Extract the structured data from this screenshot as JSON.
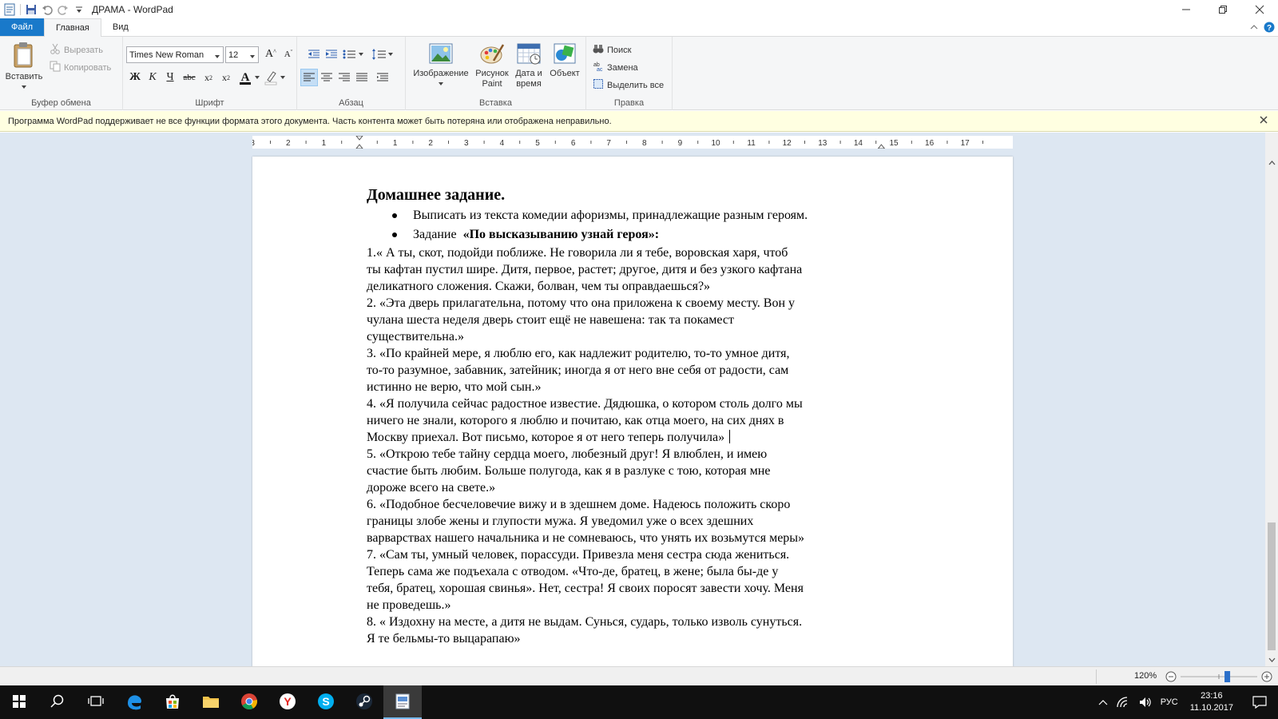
{
  "window": {
    "title": "ДРАМА - WordPad"
  },
  "tabs": {
    "file": "Файл",
    "home": "Главная",
    "view": "Вид"
  },
  "ribbon": {
    "clipboard": {
      "paste": "Вставить",
      "cut": "Вырезать",
      "copy": "Копировать",
      "label": "Буфер обмена"
    },
    "font": {
      "family": "Times New Roman",
      "size": "12",
      "label": "Шрифт",
      "bold": "Ж",
      "italic": "К",
      "underline": "Ч",
      "strike": "abc"
    },
    "paragraph": {
      "label": "Абзац"
    },
    "insert": {
      "image_line1": "Изображение",
      "paint_line1": "Рисунок",
      "paint_line2": "Paint",
      "datetime_line1": "Дата и",
      "datetime_line2": "время",
      "object": "Объект",
      "label": "Вставка"
    },
    "editing": {
      "find": "Поиск",
      "replace": "Замена",
      "select_all": "Выделить все",
      "label": "Правка"
    }
  },
  "infobar": {
    "message": "Программа WordPad поддерживает не все функции формата этого документа. Часть контента может быть потеряна или отображена неправильно."
  },
  "ruler": {
    "labels": [
      "3",
      "2",
      "1",
      "1",
      "2",
      "3",
      "4",
      "5",
      "6",
      "7",
      "8",
      "9",
      "10",
      "11",
      "12",
      "13",
      "14",
      "15",
      "16",
      "17"
    ]
  },
  "document": {
    "heading": "Домашнее задание.",
    "bullet1": "Выписать из текста комедии афоризмы, принадлежащие разным героям.",
    "bullet2_prefix": "Задание  ",
    "bullet2_bold": "«По высказыванию узнай героя»:",
    "lines": [
      "1.« А ты, скот, подойди поближе. Не говорила ли  я тебе, воровская харя, чтоб",
      "ты кафтан пустил шире. Дитя, первое, растет; другое, дитя и без узкого кафтана",
      "деликатного сложения. Скажи, болван, чем ты оправдаешься?»",
      "2. «Эта дверь прилагательна, потому что она приложена к своему месту. Вон у",
      "чулана шеста неделя дверь стоит ещё не навешена:  так та покамест",
      "существительна.»",
      "3. «По крайней мере, я люблю его, как надлежит родителю, то-то умное дитя,",
      "то-то разумное, забавник, затейник; иногда я от него вне себя от радости, сам",
      "истинно не верю, что мой сын.»",
      "4. «Я получила сейчас радостное известие. Дядюшка, о котором столь долго мы",
      "ничего не знали, которого я люблю и почитаю, как отца моего, на сих днях в",
      "Москву приехал.  Вот письмо, которое я от него теперь получила»",
      "5. «Открою тебе тайну сердца моего, любезный друг! Я влюблен, и имею",
      "счастие быть любим. Больше полугода, как я в разлуке с тою, которая мне",
      "дороже всего на свете.»",
      "6. «Подобное бесчеловечие вижу и в здешнем доме. Надеюсь положить скоро",
      "границы злобе жены и глупости мужа. Я уведомил уже о всех здешних",
      "варварствах нашего начальника и не сомневаюсь, что унять их возьмутся меры»",
      "7. «Сам ты, умный человек, порассуди. Привезла меня сестра сюда жениться.",
      "Теперь сама же подъехала с отводом. «Что-де, братец, в жене; была бы-де у",
      "тебя, братец, хорошая свинья». Нет, сестра! Я своих поросят завести хочу. Меня",
      "не проведешь.»",
      "8. « Издохну на месте, а дитя не выдам. Сунься, сударь, только изволь сунуться.",
      "Я те бельмы-то выцарапаю»"
    ]
  },
  "status": {
    "zoom": "120%",
    "zoom_level_percent": 120
  },
  "taskbar": {
    "apps": [
      "start-icon",
      "search-icon",
      "task-view-icon",
      "edge-icon",
      "store-icon",
      "explorer-icon",
      "chrome-icon",
      "yandex-icon",
      "skype-icon",
      "steam-icon",
      "wordpad-icon"
    ],
    "lang": "РУС",
    "time": "23:16",
    "date": "11.10.2017"
  },
  "colors": {
    "file_tab": "#1979ca",
    "infobar": "#ffffe1",
    "doc_background": "#dde7f2",
    "taskbar": "#101010"
  }
}
